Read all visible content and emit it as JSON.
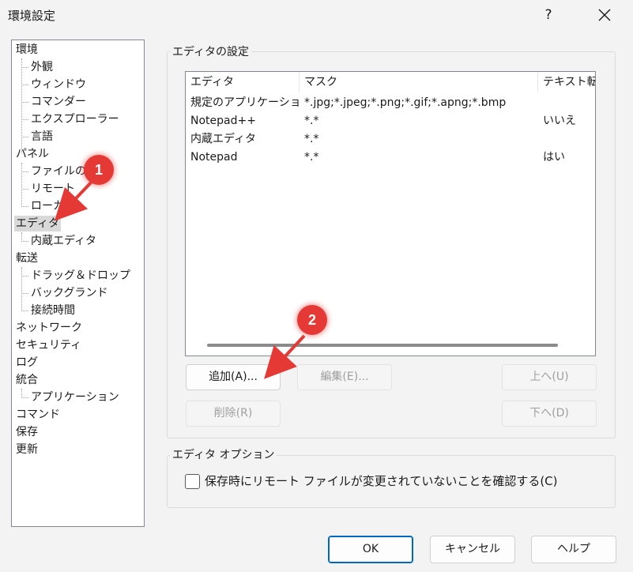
{
  "window": {
    "title": "環境設定",
    "help_label": "?"
  },
  "tree": {
    "items": [
      {
        "label": "環境",
        "level": 0,
        "selected": false
      },
      {
        "label": "外観",
        "level": 1,
        "selected": false
      },
      {
        "label": "ウィンドウ",
        "level": 1,
        "selected": false
      },
      {
        "label": "コマンダー",
        "level": 1,
        "selected": false
      },
      {
        "label": "エクスプローラー",
        "level": 1,
        "selected": false
      },
      {
        "label": "言語",
        "level": 1,
        "selected": false
      },
      {
        "label": "パネル",
        "level": 0,
        "selected": false
      },
      {
        "label": "ファイルの色",
        "level": 1,
        "selected": false
      },
      {
        "label": "リモート",
        "level": 1,
        "selected": false
      },
      {
        "label": "ローカル",
        "level": 1,
        "selected": false
      },
      {
        "label": "エディタ",
        "level": 0,
        "selected": true
      },
      {
        "label": "内蔵エディタ",
        "level": 1,
        "selected": false
      },
      {
        "label": "転送",
        "level": 0,
        "selected": false
      },
      {
        "label": "ドラッグ＆ドロップ",
        "level": 1,
        "selected": false
      },
      {
        "label": "バックグランド",
        "level": 1,
        "selected": false
      },
      {
        "label": "接続時間",
        "level": 1,
        "selected": false
      },
      {
        "label": "ネットワーク",
        "level": 0,
        "selected": false
      },
      {
        "label": "セキュリティ",
        "level": 0,
        "selected": false
      },
      {
        "label": "ログ",
        "level": 0,
        "selected": false
      },
      {
        "label": "統合",
        "level": 0,
        "selected": false
      },
      {
        "label": "アプリケーション",
        "level": 1,
        "selected": false
      },
      {
        "label": "コマンド",
        "level": 0,
        "selected": false
      },
      {
        "label": "保存",
        "level": 0,
        "selected": false
      },
      {
        "label": "更新",
        "level": 0,
        "selected": false
      }
    ]
  },
  "editor_settings": {
    "group_label": "エディタの設定",
    "columns": [
      "エディタ",
      "マスク",
      "テキスト転送"
    ],
    "rows": [
      [
        "規定のアプリケーション",
        "*.jpg;*.jpeg;*.png;*.gif;*.apng;*.bmp",
        ""
      ],
      [
        "Notepad++",
        "*.*",
        "いいえ"
      ],
      [
        "内蔵エディタ",
        "*.*",
        ""
      ],
      [
        "Notepad",
        "*.*",
        "はい"
      ]
    ],
    "buttons": {
      "add": "追加(A)...",
      "edit": "編集(E)...",
      "up": "上へ(U)",
      "remove": "削除(R)",
      "down": "下へ(D)"
    }
  },
  "editor_options": {
    "group_label": "エディタ オプション",
    "checkbox_label": "保存時にリモート ファイルが変更されていないことを確認する(C)",
    "checked": false
  },
  "footer": {
    "ok": "OK",
    "cancel": "キャンセル",
    "help": "ヘルプ"
  },
  "annotations": {
    "badge1": "1",
    "badge2": "2",
    "color": "#e53935"
  }
}
